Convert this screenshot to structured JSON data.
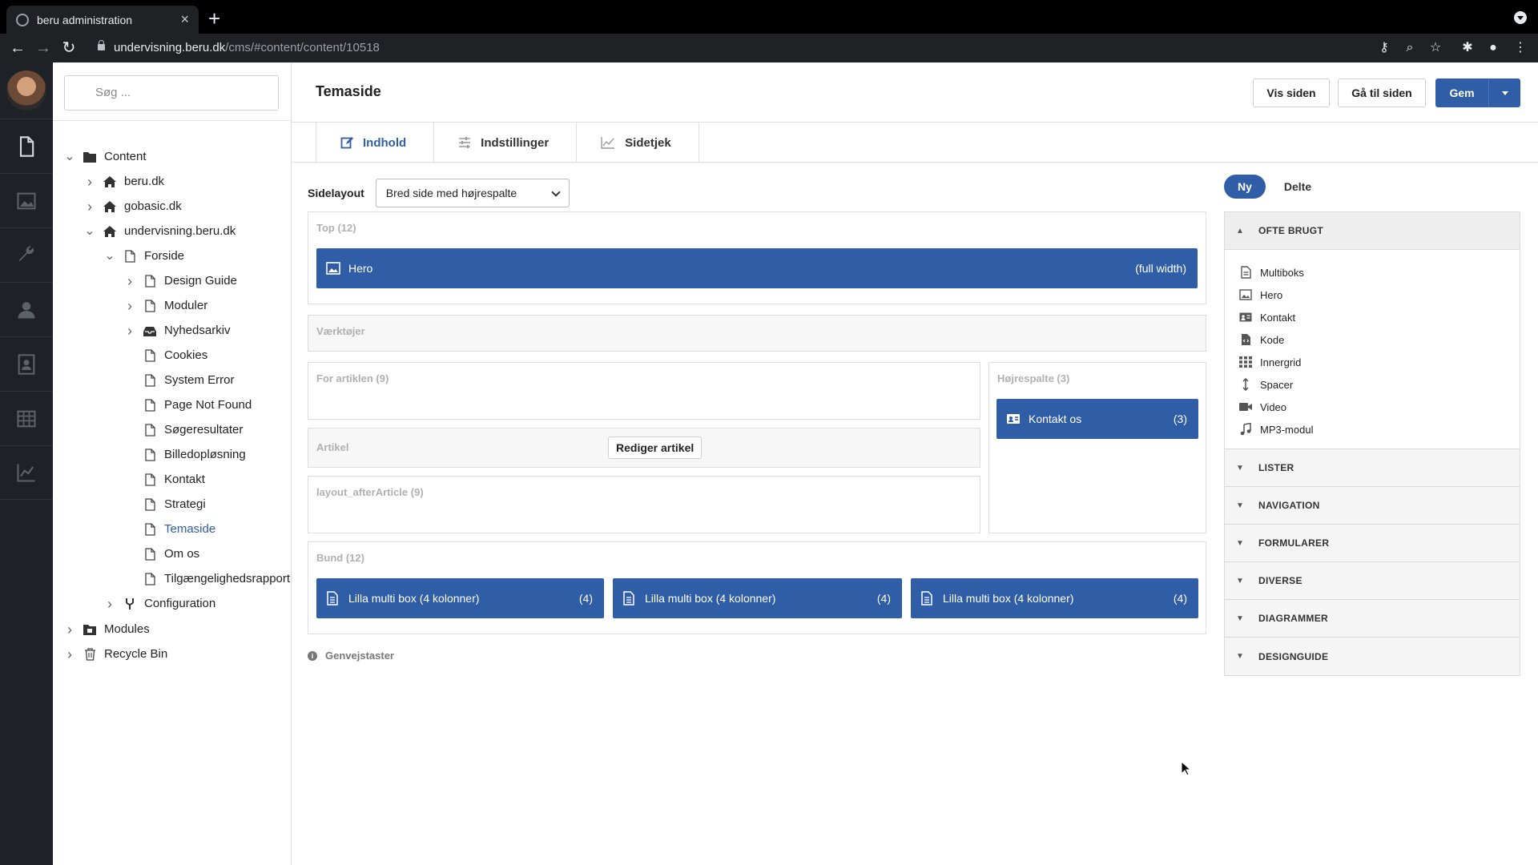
{
  "browser": {
    "tab_title": "beru administration",
    "new_tab": "+",
    "url_host": "undervisning.beru.dk",
    "url_path": "/cms/#content/content/10518"
  },
  "sidebar": {
    "search_placeholder": "Søg ...",
    "tree": [
      {
        "label": "Content",
        "icon": "folder-icon",
        "chevron": "down"
      },
      {
        "label": "beru.dk",
        "icon": "home-icon",
        "chevron": "right"
      },
      {
        "label": "gobasic.dk",
        "icon": "home-icon",
        "chevron": "right"
      },
      {
        "label": "undervisning.beru.dk",
        "icon": "home-icon",
        "chevron": "down"
      },
      {
        "label": "Forside",
        "icon": "page-icon",
        "chevron": "down"
      },
      {
        "label": "Design Guide",
        "icon": "page-icon",
        "chevron": "right"
      },
      {
        "label": "Moduler",
        "icon": "page-icon",
        "chevron": "right"
      },
      {
        "label": "Nyhedsarkiv",
        "icon": "inbox-icon",
        "chevron": "right"
      },
      {
        "label": "Cookies",
        "icon": "page-icon",
        "chevron": ""
      },
      {
        "label": "System Error",
        "icon": "page-icon",
        "chevron": ""
      },
      {
        "label": "Page Not Found",
        "icon": "page-icon",
        "chevron": ""
      },
      {
        "label": "Søgeresultater",
        "icon": "page-icon",
        "chevron": ""
      },
      {
        "label": "Billedopløsning",
        "icon": "page-icon",
        "chevron": ""
      },
      {
        "label": "Kontakt",
        "icon": "page-icon",
        "chevron": ""
      },
      {
        "label": "Strategi",
        "icon": "page-icon",
        "chevron": ""
      },
      {
        "label": "Temaside",
        "icon": "page-icon",
        "chevron": ""
      },
      {
        "label": "Om os",
        "icon": "page-icon",
        "chevron": ""
      },
      {
        "label": "Tilgængelighedsrapport",
        "icon": "page-icon",
        "chevron": ""
      },
      {
        "label": "Configuration",
        "icon": "fork-icon",
        "chevron": "right"
      },
      {
        "label": "Modules",
        "icon": "modules-icon",
        "chevron": "right"
      },
      {
        "label": "Recycle Bin",
        "icon": "trash-icon",
        "chevron": "right"
      }
    ]
  },
  "header": {
    "title": "Temaside",
    "view_button": "Vis siden",
    "goto_button": "Gå til siden",
    "save_button": "Gem"
  },
  "tabs": [
    "Indhold",
    "Indstillinger",
    "Sidetjek"
  ],
  "layout": {
    "label": "Sidelayout",
    "selected": "Bred side med højrespalte"
  },
  "zones": {
    "top": {
      "label": "Top (12)",
      "block": {
        "name": "Hero",
        "meta": "(full width)"
      }
    },
    "tools": {
      "label": "Værktøjer"
    },
    "before_article": {
      "label": "For artiklen (9)"
    },
    "right_column": {
      "label": "Højrespalte (3)",
      "block": {
        "name": "Kontakt os",
        "meta": "(3)"
      }
    },
    "article": {
      "label": "Artikel",
      "edit_button": "Rediger artikel"
    },
    "after_article": {
      "label": "layout_afterArticle (9)"
    },
    "bottom": {
      "label": "Bund (12)",
      "blocks": [
        {
          "name": "Lilla multi box (4 kolonner)",
          "meta": "(4)"
        },
        {
          "name": "Lilla multi box (4 kolonner)",
          "meta": "(4)"
        },
        {
          "name": "Lilla multi box (4 kolonner)",
          "meta": "(4)"
        }
      ]
    }
  },
  "shortcuts_hint": "Genvejstaster",
  "library": {
    "toggle_new": "Ny",
    "toggle_shared": "Delte",
    "open_section": "OFTE BRUGT",
    "items": [
      {
        "label": "Multiboks",
        "icon": "document-icon"
      },
      {
        "label": "Hero",
        "icon": "image-icon"
      },
      {
        "label": "Kontakt",
        "icon": "contact-card-icon"
      },
      {
        "label": "Kode",
        "icon": "code-file-icon"
      },
      {
        "label": "Innergrid",
        "icon": "grid-icon"
      },
      {
        "label": "Spacer",
        "icon": "vertical-arrows-icon"
      },
      {
        "label": "Video",
        "icon": "video-icon"
      },
      {
        "label": "MP3-modul",
        "icon": "music-note-icon"
      }
    ],
    "collapsed_sections": [
      "LISTER",
      "NAVIGATION",
      "FORMULARER",
      "DIVERSE",
      "DIAGRAMMER",
      "DESIGNGUIDE"
    ]
  },
  "colors": {
    "primary": "#2f5da6",
    "rail": "#1e2126"
  }
}
